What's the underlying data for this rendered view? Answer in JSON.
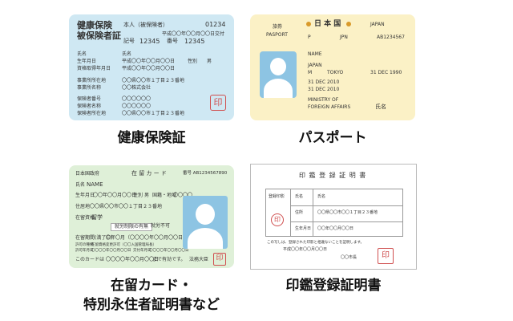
{
  "health": {
    "title_line1": "健康保険",
    "title_line2": "被保険者証",
    "honin": "本人（被保険者）",
    "number": "01234",
    "issued": "平成〇〇年〇〇月〇〇日交付",
    "kigo_label": "記号",
    "kigo": "12345",
    "bango_label": "番号",
    "bango": "12345",
    "name_label": "氏名",
    "name_value": "氏名",
    "dob_label": "生年月日",
    "dob_value": "平成〇〇年〇〇月〇〇日",
    "sex_label": "性別",
    "sex_value": "男",
    "qual_label": "資格取得年月日",
    "qual_value": "平成〇〇年〇〇月〇〇日",
    "office_addr_label": "事業所所在地",
    "office_addr_value": "〇〇県〇〇市１丁目２３番地",
    "office_name_label": "事業所名称",
    "office_name_value": "〇〇株式会社",
    "insurer_no_label": "保険者番号",
    "insurer_no_value": "〇〇〇〇〇〇",
    "insurer_name_label": "保険者名称",
    "insurer_name_value": "〇〇〇〇〇〇",
    "insurer_addr_label": "保険者所在地",
    "insurer_addr_value": "〇〇県〇〇市１丁目２３番地",
    "seal": "印",
    "caption": "健康保険証"
  },
  "passport": {
    "type_label": "旅券",
    "type_en": "PASPORT",
    "country_jp": "日 本 国",
    "country_en": "JAPAN",
    "p_code": "P",
    "jpn": "JPN",
    "number": "AB1234567",
    "name": "NAME",
    "nationality": "JAPAN",
    "sex": "M",
    "birthplace": "TOKYO",
    "dob": "31 DEC 1990",
    "issue": "31 DEC 2010",
    "expiry": "31 DEC 2010",
    "authority_line1": "MINISTRY OF",
    "authority_line2": "FOREIGN AFFAIRS",
    "signature": "氏名",
    "caption": "パスポート"
  },
  "residence": {
    "header_left": "日本国政府",
    "header_center": "在 留 カ ー ド",
    "header_right": "番号 AB1234567890",
    "name_label": "氏名",
    "name_value": "NAME",
    "dob_label": "生年月日",
    "dob_value": "〇〇年〇〇月〇〇日",
    "sex_label": "性別",
    "sex_value": "男",
    "nationality_label": "国籍・地域",
    "nationality_value": "〇〇〇〇",
    "addr_label": "住居地",
    "addr_value": "〇〇県〇〇市〇〇１丁目２３番地",
    "status_label": "在留資格",
    "status_value": "留学",
    "work_label": "就労制限の有無",
    "work_value": "就労不可",
    "period_label": "在留期間(満了日)",
    "period_value": "〇年〇月（〇〇〇〇年〇〇月〇〇日）",
    "permit_label": "許可の種類",
    "permit_value": "在留資格変更許可（〇〇入国管理局長）",
    "permit_date_label": "許可年月日",
    "permit_date_value": "〇〇〇〇年〇〇月〇〇日",
    "issue_date_label": "交付年月日",
    "issue_date_value": "〇〇〇〇年〇〇月〇〇日",
    "validity_label": "このカードは",
    "validity_value": "〇〇〇〇年〇〇月〇〇日",
    "validity_suffix": "まで有効です。",
    "minister": "法務大臣",
    "seal": "印",
    "caption_line1": "在留カード・",
    "caption_line2": "特別永住者証明書など"
  },
  "seal_cert": {
    "title": "印 鑑 登 録 証 明 書",
    "row1_col1": "登録印影",
    "row1_col2": "氏名",
    "row1_col3": "氏名",
    "row2_col2": "住所",
    "row2_col3": "〇〇県〇〇市〇〇１丁目２３番地",
    "row3_col2": "生年月日",
    "row3_col3": "〇〇年〇〇月〇〇日",
    "note": "この写しは、登録された印影と相違ないことを証明します。",
    "date": "平成〇〇年〇〇月〇〇日",
    "mayor": "〇〇市長",
    "seal_text": "印",
    "caption": "印鑑登録証明書"
  },
  "colors": {
    "health_bg": "#cfe8f3",
    "passport_bg": "#fbf1c6",
    "residence_bg": "#dff0d8",
    "silhouette_bg": "#8dc4e3",
    "seal_red": "#d05050",
    "passport_dot": "#d99a2b"
  }
}
